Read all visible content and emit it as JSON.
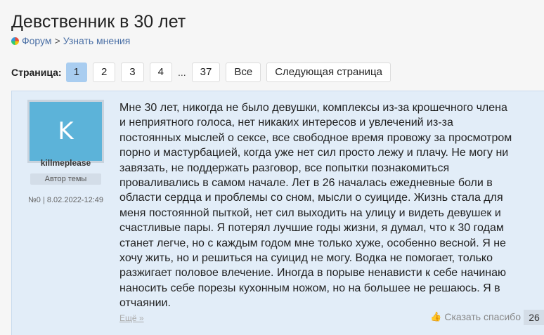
{
  "page": {
    "title": "Девственник в 30 лет"
  },
  "breadcrumb": {
    "forum": "Форум",
    "separator": ">",
    "section": "Узнать мнения"
  },
  "pager": {
    "label": "Страница:",
    "pages": [
      "1",
      "2",
      "3",
      "4"
    ],
    "current": "1",
    "ellipsis": "...",
    "last": "37",
    "all": "Все",
    "next": "Следующая страница"
  },
  "post": {
    "author": {
      "avatar_letter": "K",
      "avatar_color": "#5cb3d9",
      "name": "killmeplease",
      "badge": "Автор темы",
      "meta": "№0 | 8.02.2022-12:49"
    },
    "lines": [
      "Мне 30 лет, никогда не было девушки, комплексы из-за крошечного члена",
      "и неприятного голоса, нет никаких интересов и увлечений из-за",
      "постоянных мыслей о сексе, все свободное время провожу за просмотром",
      "порно и мастурбацией, когда уже нет сил просто лежу и плачу. Не могу ни",
      "завязать, не поддержать разговор, все попытки познакомиться",
      "проваливались в самом начале. Лет в 26 началась ежедневные боли в",
      "области сердца и проблемы со сном, мысли о суициде. Жизнь стала для",
      "меня постоянной пыткой, нет сил выходить на улицу и видеть девушек и",
      "счастливые пары. Я потерял лучшие годы жизни, я думал, что к 30 годам",
      "станет легче, но с каждым годом мне только хуже, особенно весной. Я не",
      "хочу жить, но и решиться на суицид не могу. Водка не помогает, только",
      "разжигает половое влечение. Иногда в порыве ненависти к себе начинаю",
      "наносить себе порезы кухонным ножом, но на большее не решаюсь. Я в",
      "отчаянии."
    ],
    "more": "Ещё »",
    "thanks_label": "Сказать спасибо",
    "thanks_count": "26",
    "accent_color": "#a9cdf0"
  }
}
